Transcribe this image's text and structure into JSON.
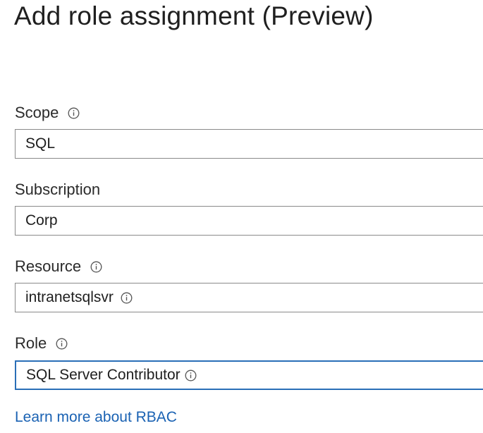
{
  "title": "Add role assignment (Preview)",
  "fields": {
    "scope": {
      "label": "Scope",
      "value": "SQL"
    },
    "subscription": {
      "label": "Subscription",
      "value": "Corp"
    },
    "resource": {
      "label": "Resource",
      "value": "intranetsqlsvr"
    },
    "role": {
      "label": "Role",
      "value": "SQL Server Contributor"
    }
  },
  "learn_more": "Learn more about RBAC",
  "colors": {
    "accent_border": "#2a6fb7",
    "link": "#1a62b3",
    "field_border": "#8a8a8a"
  },
  "icons": {
    "info": "info-icon"
  }
}
